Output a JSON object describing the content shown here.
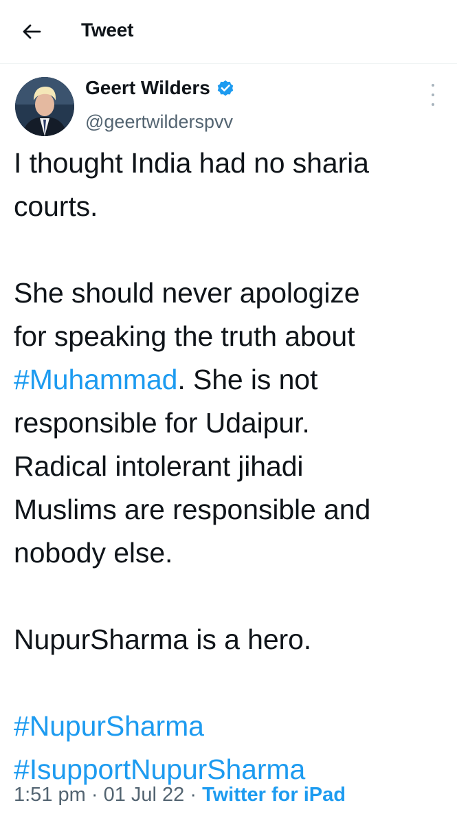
{
  "header": {
    "back_icon": "arrow-left-icon",
    "title": "Tweet"
  },
  "author": {
    "display_name": "Geert Wilders",
    "handle": "@geertwilderspvv",
    "verified_icon": "verified-badge-icon",
    "more_icon": "more-vertical-icon"
  },
  "tweet": {
    "line1": "I thought India had no sharia",
    "line2": "courts.",
    "para2_a": "She should never apologize",
    "para2_b": "for speaking the truth about",
    "hashtag_muhammad": "#Muhammad",
    "para2_c": ". She is not",
    "para2_d": "responsible for Udaipur.",
    "para2_e": "Radical intolerant jihadi",
    "para2_f": "Muslims are responsible and",
    "para2_g": "nobody else.",
    "para3": "NupurSharma is a hero.",
    "hashtag_1": "#NupurSharma",
    "hashtag_2": "#IsupportNupurSharma"
  },
  "meta": {
    "time": "1:51 pm",
    "separator": " · ",
    "date": "01 Jul 22",
    "source": "Twitter for iPad"
  },
  "colors": {
    "link": "#1d9bf0",
    "secondary_text": "#536471",
    "primary_text": "#0f1419"
  }
}
